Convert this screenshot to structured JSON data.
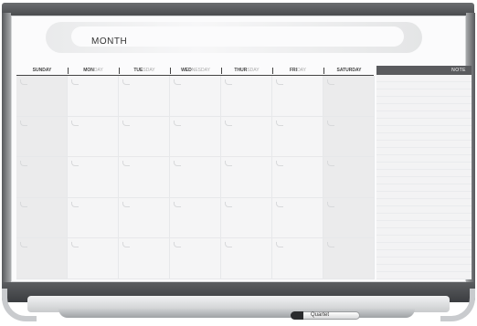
{
  "calendar": {
    "month_label": "MONTH",
    "note_label": "NOTE",
    "days": [
      {
        "strong": "SUNDAY",
        "faint": ""
      },
      {
        "strong": "MON",
        "faint": "DAY"
      },
      {
        "strong": "TUE",
        "faint": "SDAY"
      },
      {
        "strong": "WED",
        "faint": "NESDAY"
      },
      {
        "strong": "THUR",
        "faint": "SDAY"
      },
      {
        "strong": "FRI",
        "faint": "DAY"
      },
      {
        "strong": "SATURDAY",
        "faint": ""
      }
    ],
    "weeks": 5
  },
  "marker": {
    "brand": "Quartet"
  },
  "colors": {
    "frame": "#4a4c4f",
    "weekend_shade": "#ebebec",
    "note_header": "#5a5b5e"
  }
}
